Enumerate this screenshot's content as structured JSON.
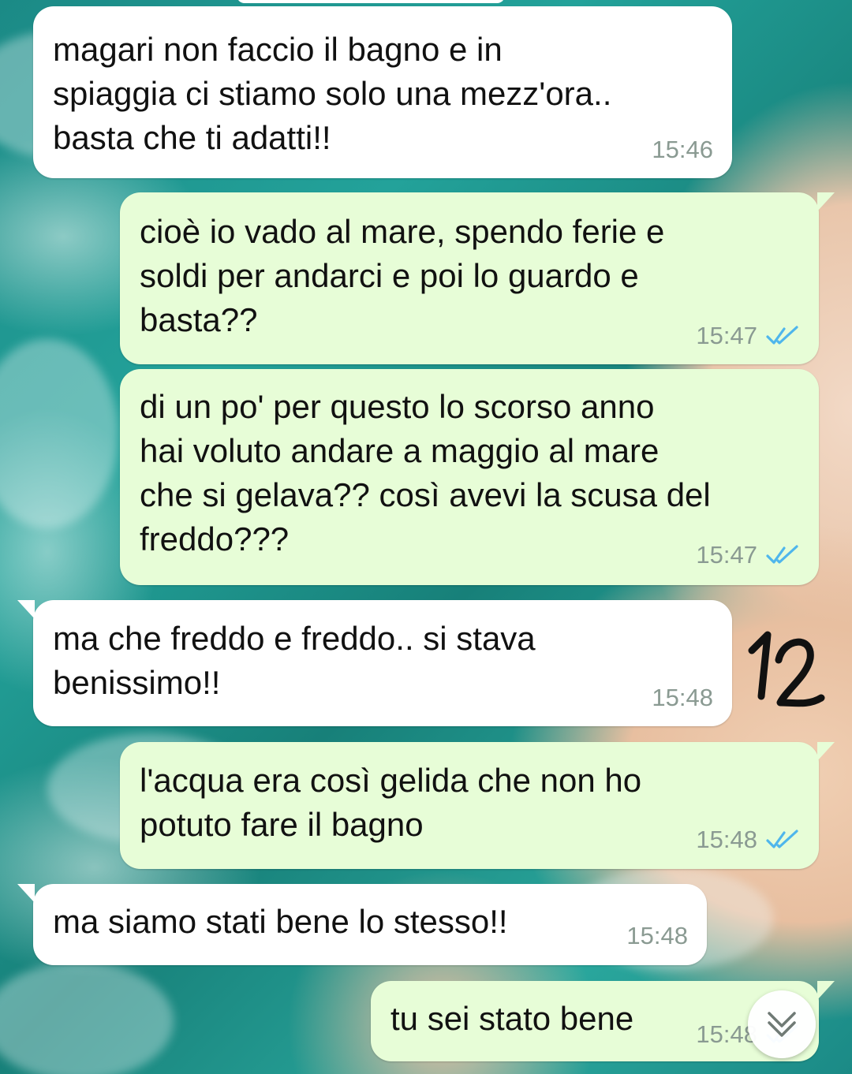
{
  "chat": {
    "messages": [
      {
        "direction": "incoming",
        "text": "magari non faccio il bagno e in\nspiaggia ci stiamo solo una mezz'ora..\nbasta che ti adatti!!",
        "time": "15:46",
        "read": false
      },
      {
        "direction": "outgoing",
        "text": "cioè io vado al mare, spendo ferie e\nsoldi per andarci e poi lo guardo e\nbasta??",
        "time": "15:47",
        "read": true
      },
      {
        "direction": "outgoing",
        "text": "di un po' per questo lo scorso anno\nhai voluto andare a maggio al mare\nche si gelava?? così avevi la scusa del\nfreddo???",
        "time": "15:47",
        "read": true
      },
      {
        "direction": "incoming",
        "text": "ma che freddo e freddo.. si stava\nbenissimo!!",
        "time": "15:48",
        "read": false
      },
      {
        "direction": "outgoing",
        "text": "l'acqua era così gelida che non ho\npotuto fare il bagno",
        "time": "15:48",
        "read": true
      },
      {
        "direction": "incoming",
        "text": "ma siamo stati bene lo stesso!!",
        "time": "15:48",
        "read": false
      },
      {
        "direction": "outgoing",
        "text": "tu sei stato bene",
        "time": "15:48",
        "read": true
      }
    ]
  },
  "annotation": {
    "text": "12"
  },
  "colors": {
    "incoming_bubble": "#ffffff",
    "outgoing_bubble": "#e7fdd7",
    "read_ticks": "#4fb6ec",
    "timestamp": "#8a9a92"
  },
  "icons": {
    "read_receipt": "double-check-icon",
    "scroll_down": "double-chevron-down-icon"
  }
}
